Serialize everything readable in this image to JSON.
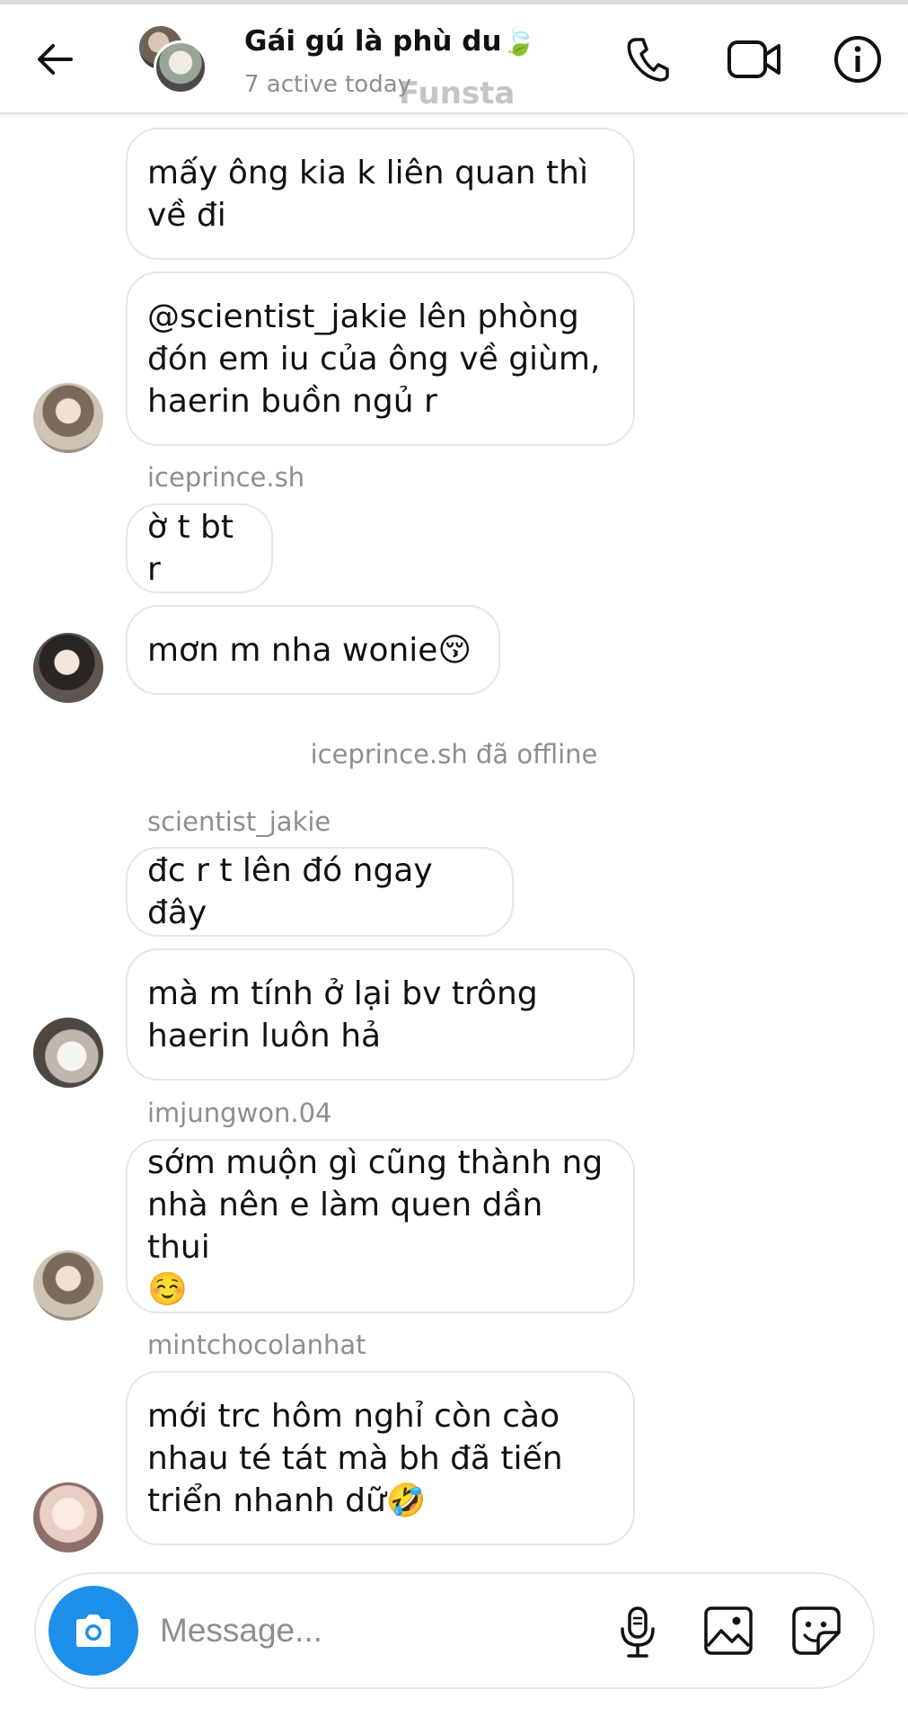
{
  "header": {
    "title": "Gái gú là phù du🍃",
    "subtitle": "7 active today",
    "watermark": "Funsta",
    "icons": [
      "back-arrow-icon",
      "phone-icon",
      "video-camera-icon",
      "info-icon"
    ]
  },
  "messages": [
    {
      "text": "mấy ông kia k liên quan thì\nvề đi"
    },
    {
      "text": "@scientist_jakie lên phòng\nđón em iu của ông về giùm,\nhaerin buồn ngủ r"
    },
    {
      "text": "ờ t bt r"
    },
    {
      "text": "mơn m nha wonie😚"
    },
    {
      "text": "đc r t lên đó ngay đây"
    },
    {
      "text": "mà m tính ở lại bv trông\nhaerin luôn hả"
    },
    {
      "text": "sớm muộn gì cũng thành ng\nnhà nên e làm quen dần thui\n☺️"
    },
    {
      "text": "mới trc hôm nghỉ còn cào\nnhau té tát mà bh đã tiến\ntriển nhanh dữ🤣"
    }
  ],
  "senders": {
    "iceprince": "iceprince.sh",
    "scientist": "scientist_jakie",
    "imjungwon": "imjungwon.04",
    "mintchoco": "mintchocolanhat"
  },
  "system_notice": "iceprince.sh đã offline",
  "composer": {
    "placeholder": "Message...",
    "value": "",
    "icons": [
      "camera-icon",
      "microphone-icon",
      "gallery-icon",
      "sticker-icon"
    ]
  },
  "colors": {
    "accent": "#1d8fe9",
    "muted_text": "#8e8e8e",
    "bubble_border": "#e6e6e6"
  }
}
